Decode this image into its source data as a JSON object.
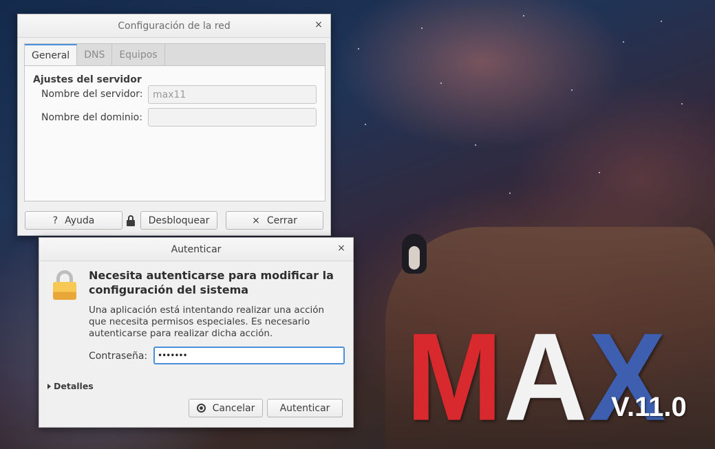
{
  "network_window": {
    "title": "Configuración de la red",
    "close_glyph": "×",
    "tabs": [
      {
        "label": "General",
        "active": true
      },
      {
        "label": "DNS",
        "active": false
      },
      {
        "label": "Equipos",
        "active": false
      }
    ],
    "section_title": "Ajustes del servidor",
    "server_name_label": "Nombre del servidor:",
    "server_name_value": "max11",
    "domain_name_label": "Nombre del dominio:",
    "domain_name_value": "",
    "help_button": {
      "label": "Ayuda",
      "icon": "question-icon",
      "glyph": "?"
    },
    "unlock_button": {
      "label": "Desbloquear",
      "icon": "lock-icon"
    },
    "close_button": {
      "label": "Cerrar",
      "icon": "close-icon",
      "glyph": "×"
    }
  },
  "auth_window": {
    "title": "Autenticar",
    "close_glyph": "×",
    "heading": "Necesita autenticarse para modificar la configuración del sistema",
    "description": "Una aplicación está intentando realizar una acción que necesita permisos especiales. Es necesario autenticarse para realizar dicha acción.",
    "password_label": "Contraseña:",
    "password_value": "•••••••",
    "details_label": "Detalles",
    "cancel_button": "Cancelar",
    "authenticate_button": "Autenticar"
  },
  "wallpaper": {
    "logo_letters": [
      "M",
      "A",
      "X"
    ],
    "version": "V.11.0",
    "colors": {
      "m": "#d82a2e",
      "a": "#f2f2f2",
      "x": "#3e5fb0"
    }
  }
}
